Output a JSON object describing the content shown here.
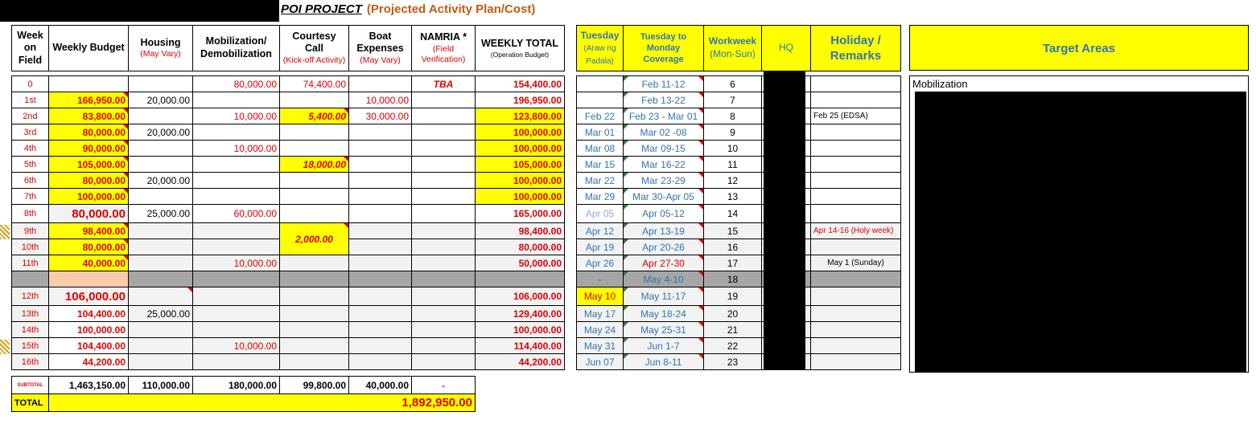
{
  "title": {
    "main": "POI PROJECT",
    "subtitle": "(Projected Activity Plan/Cost)"
  },
  "headers": {
    "week": "Week on Field",
    "budget": "Weekly Budget",
    "housing": "Housing",
    "housing_note": "(May Vary)",
    "mob": "Mobilization/ Demobilization",
    "courtesy": "Courtesy Call",
    "courtesy_note": "(Kick-off Activity)",
    "boat": "Boat Expenses",
    "boat_note": "(May Vary)",
    "namria": "NAMRIA *",
    "namria_note": "(Field Verification)",
    "total": "WEEKLY TOTAL",
    "total_note": "(Operation Budget)",
    "tuesday": "Tuesday",
    "tuesday_note": "(Araw ng Padala)",
    "coverage": "Tuesday to Monday Coverage",
    "workweek": "Workweek",
    "workweek_note": "(Mon-Sun)",
    "hq": "HQ",
    "holiday": "Holiday / Remarks",
    "target": "Target Areas"
  },
  "rows": [
    {
      "week": "0",
      "budget": "",
      "housing": "",
      "mob": "80,000.00",
      "courtesy": "74,400.00",
      "boat": "",
      "namria": "TBA",
      "total": "154,400.00",
      "tue": "",
      "cov": "Feb 11-12",
      "ww": "6",
      "rem": ""
    },
    {
      "week": "1st",
      "budget": "166,950.00",
      "housing": "20,000.00",
      "mob": "",
      "courtesy": "",
      "boat": "10,000.00",
      "namria": "",
      "total": "196,950.00",
      "tue": "",
      "cov": "Feb 13-22",
      "ww": "7",
      "rem": ""
    },
    {
      "week": "2nd",
      "budget": "83,800.00",
      "housing": "",
      "mob": "10,000.00",
      "courtesy": "5,400.00",
      "boat": "30,000.00",
      "namria": "",
      "total": "123,800.00",
      "tue": "Feb 22",
      "cov": "Feb 23 - Mar 01",
      "ww": "8",
      "rem": "Feb 25 (EDSA)"
    },
    {
      "week": "3rd",
      "budget": "80,000.00",
      "housing": "20,000.00",
      "mob": "",
      "courtesy": "",
      "boat": "",
      "namria": "",
      "total": "100,000.00",
      "tue": "Mar 01",
      "cov": "Mar 02 -08",
      "ww": "9",
      "rem": ""
    },
    {
      "week": "4th",
      "budget": "90,000.00",
      "housing": "",
      "mob": "10,000.00",
      "courtesy": "",
      "boat": "",
      "namria": "",
      "total": "100,000.00",
      "tue": "Mar 08",
      "cov": "Mar 09-15",
      "ww": "10",
      "rem": ""
    },
    {
      "week": "5th",
      "budget": "105,000.00",
      "housing": "",
      "mob": "",
      "courtesy": "18,000.00",
      "boat": "",
      "namria": "",
      "total": "105,000.00",
      "tue": "Mar 15",
      "cov": "Mar 16-22",
      "ww": "11",
      "rem": ""
    },
    {
      "week": "6th",
      "budget": "80,000.00",
      "housing": "20,000.00",
      "mob": "",
      "courtesy": "",
      "boat": "",
      "namria": "",
      "total": "100,000.00",
      "tue": "Mar 22",
      "cov": "Mar 23-29",
      "ww": "12",
      "rem": ""
    },
    {
      "week": "7th",
      "budget": "100,000.00",
      "housing": "",
      "mob": "",
      "courtesy": "",
      "boat": "",
      "namria": "",
      "total": "100,000.00",
      "tue": "Mar 29",
      "cov": "Mar 30-Apr 05",
      "ww": "13",
      "rem": ""
    },
    {
      "week": "8th",
      "budget": "80,000.00",
      "housing": "25,000.00",
      "mob": "60,000.00",
      "courtesy": "",
      "boat": "",
      "namria": "",
      "total": "165,000.00",
      "tue": "Apr 05",
      "cov": "Apr 05-12",
      "ww": "14",
      "rem": ""
    },
    {
      "week": "9th",
      "budget": "98,400.00",
      "housing": "",
      "mob": "",
      "courtesy": "2,000.00",
      "boat": "",
      "namria": "",
      "total": "98,400.00",
      "tue": "Apr 12",
      "cov": "Apr 13-19",
      "ww": "15",
      "rem": "Apr 14-16 (Holy week)"
    },
    {
      "week": "10th",
      "budget": "80,000.00",
      "housing": "",
      "mob": "",
      "courtesy": "",
      "boat": "",
      "namria": "",
      "total": "80,000.00",
      "tue": "Apr 19",
      "cov": "Apr 20-26",
      "ww": "16",
      "rem": ""
    },
    {
      "week": "11th",
      "budget": "40,000.00",
      "housing": "",
      "mob": "10,000.00",
      "courtesy": "",
      "boat": "",
      "namria": "",
      "total": "50,000.00",
      "tue": "Apr 26",
      "cov": "Apr 27-30",
      "ww": "17",
      "rem": "May 1 (Sunday)"
    },
    {
      "week": "",
      "budget": "",
      "housing": "",
      "mob": "",
      "courtesy": "",
      "boat": "",
      "namria": "",
      "total": "",
      "tue": "-",
      "cov": "May 4-10",
      "ww": "18",
      "rem": ""
    },
    {
      "week": "12th",
      "budget": "106,000.00",
      "housing": "",
      "mob": "",
      "courtesy": "",
      "boat": "",
      "namria": "",
      "total": "106,000.00",
      "tue": "May 10",
      "cov": "May 11-17",
      "ww": "19",
      "rem": ""
    },
    {
      "week": "13th",
      "budget": "104,400.00",
      "housing": "25,000.00",
      "mob": "",
      "courtesy": "",
      "boat": "",
      "namria": "",
      "total": "129,400.00",
      "tue": "May 17",
      "cov": "May 18-24",
      "ww": "20",
      "rem": ""
    },
    {
      "week": "14th",
      "budget": "100,000.00",
      "housing": "",
      "mob": "",
      "courtesy": "",
      "boat": "",
      "namria": "",
      "total": "100,000.00",
      "tue": "May 24",
      "cov": "May 25-31",
      "ww": "21",
      "rem": ""
    },
    {
      "week": "15th",
      "budget": "104,400.00",
      "housing": "",
      "mob": "10,000.00",
      "courtesy": "",
      "boat": "",
      "namria": "",
      "total": "114,400.00",
      "tue": "May 31",
      "cov": "Jun 1-7",
      "ww": "22",
      "rem": ""
    },
    {
      "week": "16th",
      "budget": "44,200.00",
      "housing": "",
      "mob": "",
      "courtesy": "",
      "boat": "",
      "namria": "",
      "total": "44,200.00",
      "tue": "Jun 07",
      "cov": "Jun 8-11",
      "ww": "23",
      "rem": ""
    }
  ],
  "subtotal": {
    "label": "SUBTOTAL",
    "budget": "1,463,150.00",
    "housing": "110,000.00",
    "mob": "180,000.00",
    "courtesy": "99,800.00",
    "boat": "40,000.00",
    "namria": "-"
  },
  "total": {
    "label": "TOTAL",
    "value": "1,892,950.00"
  },
  "target_first": "Mobilization",
  "colors": {
    "yellow": "#ffff00",
    "red": "#e00000",
    "blue": "#2e75b6",
    "orange": "#c55a11",
    "grey": "#a6a6a6",
    "salmon": "#f8cbad"
  }
}
